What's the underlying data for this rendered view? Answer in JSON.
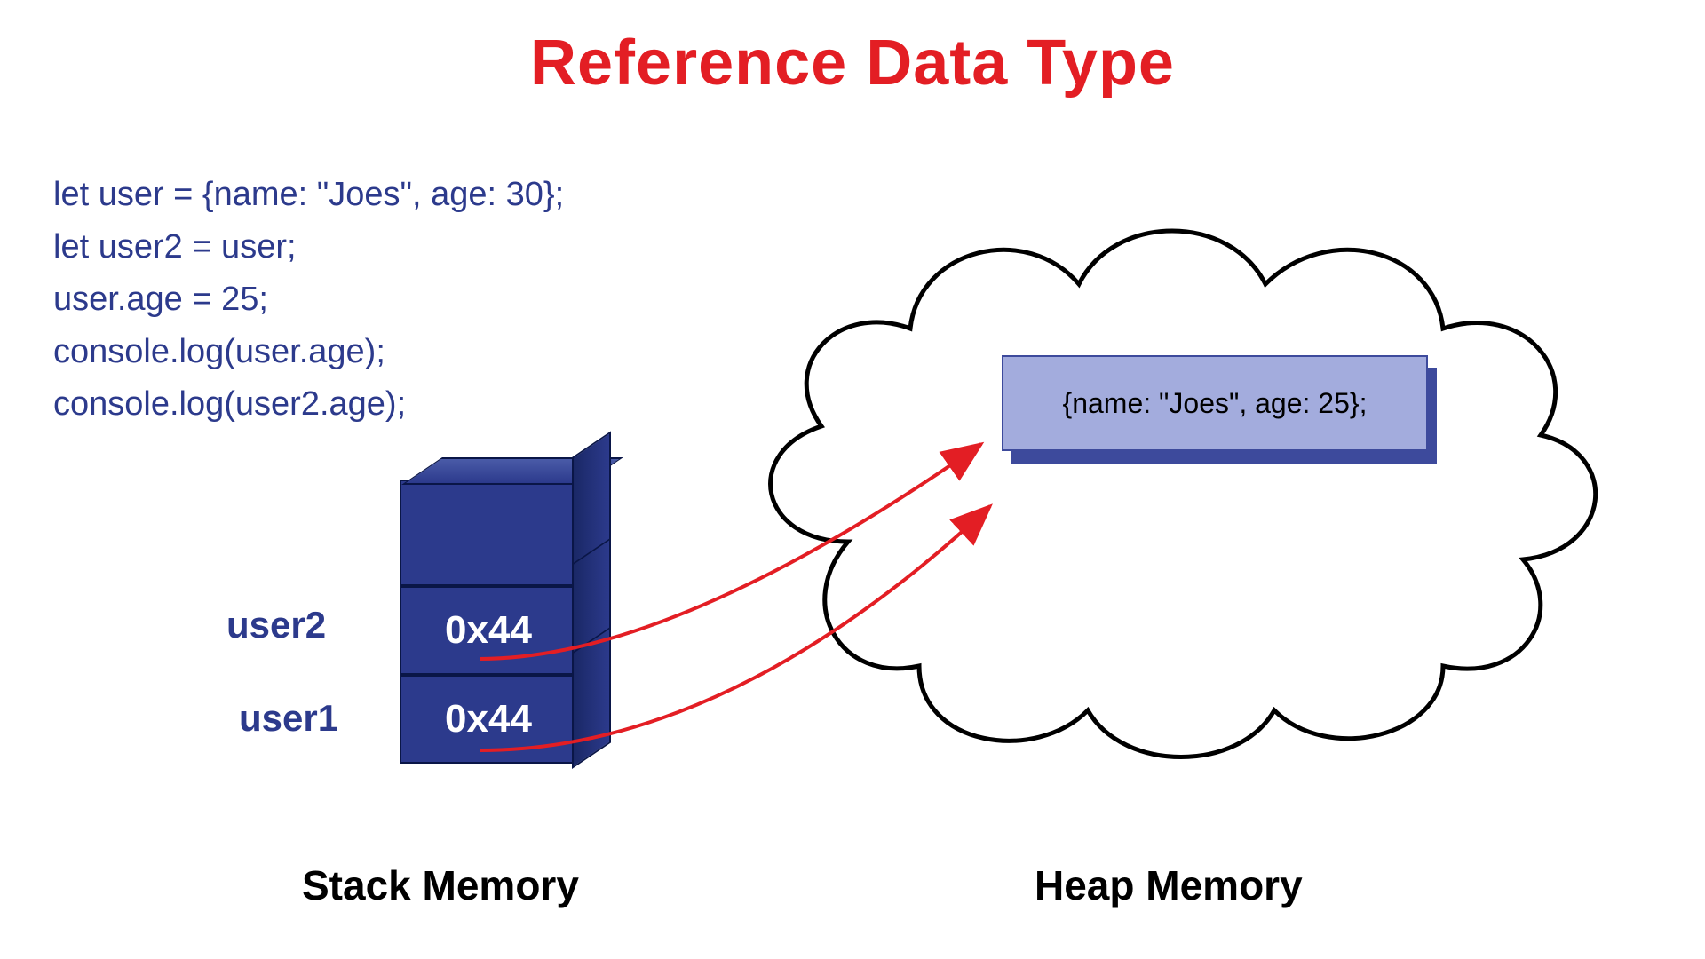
{
  "title": "Reference Data Type",
  "code": {
    "line1": "let user = {name: \"Joes\", age: 30};",
    "line2": "let user2 = user;",
    "line3": "user.age = 25;",
    "line4": "console.log(user.age);",
    "line5": "console.log(user2.age);"
  },
  "stack": {
    "slots": [
      {
        "label": "user2",
        "address": "0x44"
      },
      {
        "label": "user1",
        "address": "0x44"
      }
    ]
  },
  "heap": {
    "object": "{name: \"Joes\", age: 25};"
  },
  "labels": {
    "stack_memory": "Stack Memory",
    "heap_memory": "Heap Memory"
  },
  "colors": {
    "title_red": "#e31e24",
    "code_blue": "#2c3a8c",
    "heap_fill": "#a3acdd",
    "heap_border": "#3d4a9c",
    "arrow_red": "#e31e24"
  }
}
